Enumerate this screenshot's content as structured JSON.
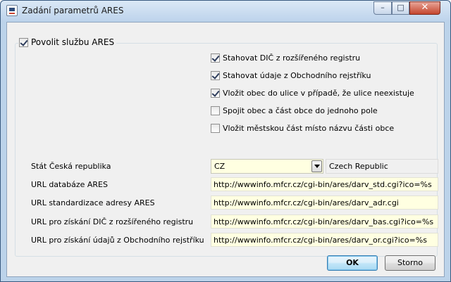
{
  "window": {
    "title": "Zadání parametrů ARES",
    "controls": {
      "minimize": "–",
      "maximize": "□",
      "close": "✕"
    }
  },
  "group": {
    "label": "Povolit službu ARES",
    "checked": true,
    "options": [
      {
        "label": "Stahovat DIČ z rozšířeného registru",
        "checked": true
      },
      {
        "label": "Stahovat údaje z Obchodního rejstříku",
        "checked": true
      },
      {
        "label": "Vložit obec do ulice v případě, že ulice neexistuje",
        "checked": true
      },
      {
        "label": "Spojit obec a část obce do jednoho pole",
        "checked": false
      },
      {
        "label": "Vložit městskou část místo názvu části obce",
        "checked": false
      }
    ]
  },
  "fields": {
    "country": {
      "label": "Stát Česká republika",
      "code": "CZ",
      "name": "Czech Republic"
    },
    "url_db": {
      "label": "URL databáze ARES",
      "value": "http://wwwinfo.mfcr.cz/cgi-bin/ares/darv_std.cgi?ico=%s"
    },
    "url_address": {
      "label": "URL standardizace adresy ARES",
      "value": "http://wwwinfo.mfcr.cz/cgi-bin/ares/darv_adr.cgi"
    },
    "url_dic": {
      "label": "URL pro získání DIČ z rozšířeného registru",
      "value": "http://wwwinfo.mfcr.cz/cgi-bin/ares/darv_bas.cgi?ico=%s"
    },
    "url_or": {
      "label": "URL pro získání údajů z Obchodního rejstříku",
      "value": "http://wwwinfo.mfcr.cz/cgi-bin/ares/darv_or.cgi?ico=%s"
    }
  },
  "buttons": {
    "ok": "OK",
    "cancel": "Storno"
  }
}
